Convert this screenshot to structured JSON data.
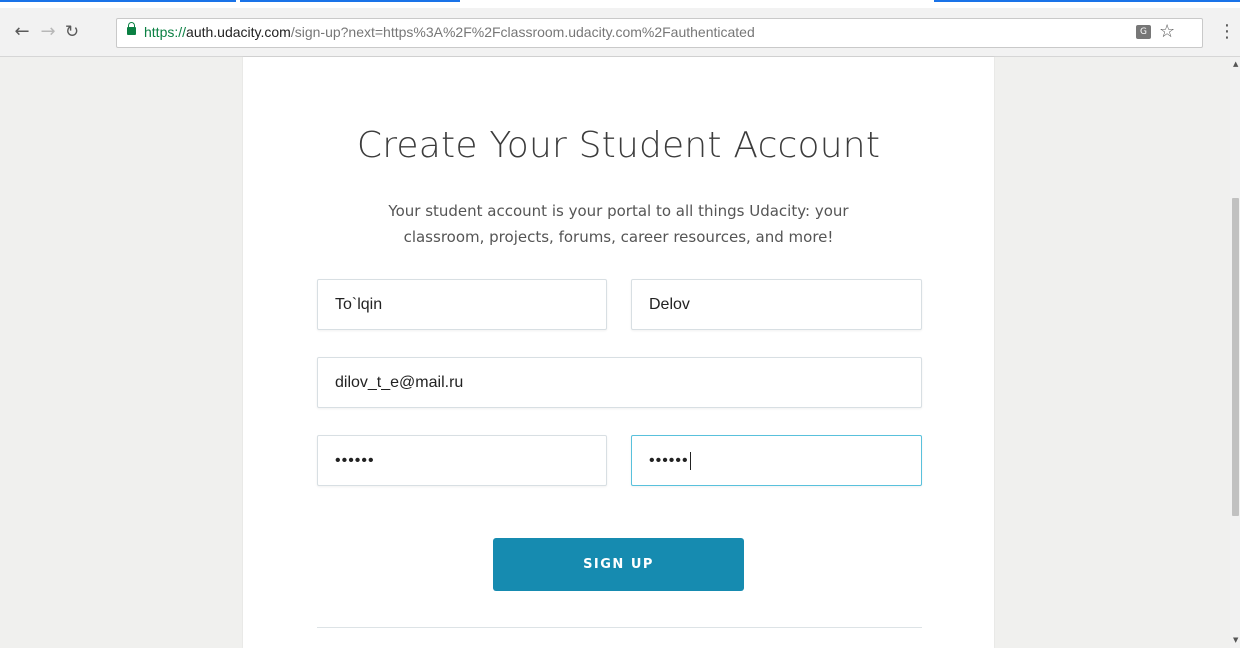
{
  "browser": {
    "url_scheme": "https://",
    "url_host": "auth.udacity.com",
    "url_path": "/sign-up?next=https%3A%2F%2Fclassroom.udacity.com%2Fauthenticated",
    "icons": [
      "back-arrow-icon",
      "forward-arrow-icon",
      "reload-icon",
      "lock-icon",
      "translate-icon",
      "star-icon",
      "menu-icon"
    ]
  },
  "page": {
    "title": "Create Your Student Account",
    "subtitle_line1": "Your student account is your portal to all things Udacity: your",
    "subtitle_line2": "classroom, projects, forums, career resources, and more!",
    "form": {
      "first_name": "To`lqin",
      "last_name": "Delov",
      "email": "dilov_t_e@mail.ru",
      "password": "••••••",
      "confirm_password": "••••••"
    },
    "signup_label": "SIGN UP"
  },
  "colors": {
    "button": "#168bb0",
    "focus_border": "#59c1dc",
    "secure_green": "#0b8043"
  }
}
